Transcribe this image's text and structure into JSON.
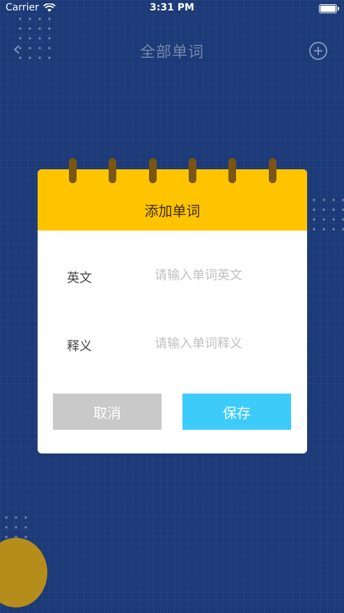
{
  "status_bar": {
    "carrier": "Carrier",
    "time": "3:31 PM"
  },
  "nav": {
    "title": "全部单词",
    "back_icon": "chevron-left-icon",
    "add_icon": "plus-circle-icon"
  },
  "dialog": {
    "title": "添加单词",
    "english_label": "英文",
    "english_placeholder": "请输入单词英文",
    "meaning_label": "释义",
    "meaning_placeholder": "请输入单词释义",
    "cancel_label": "取消",
    "save_label": "保存"
  },
  "colors": {
    "background": "#1c3a78",
    "header_accent": "#ffc400",
    "save_button": "#3dcbfa",
    "cancel_button": "#c9c9c9"
  }
}
